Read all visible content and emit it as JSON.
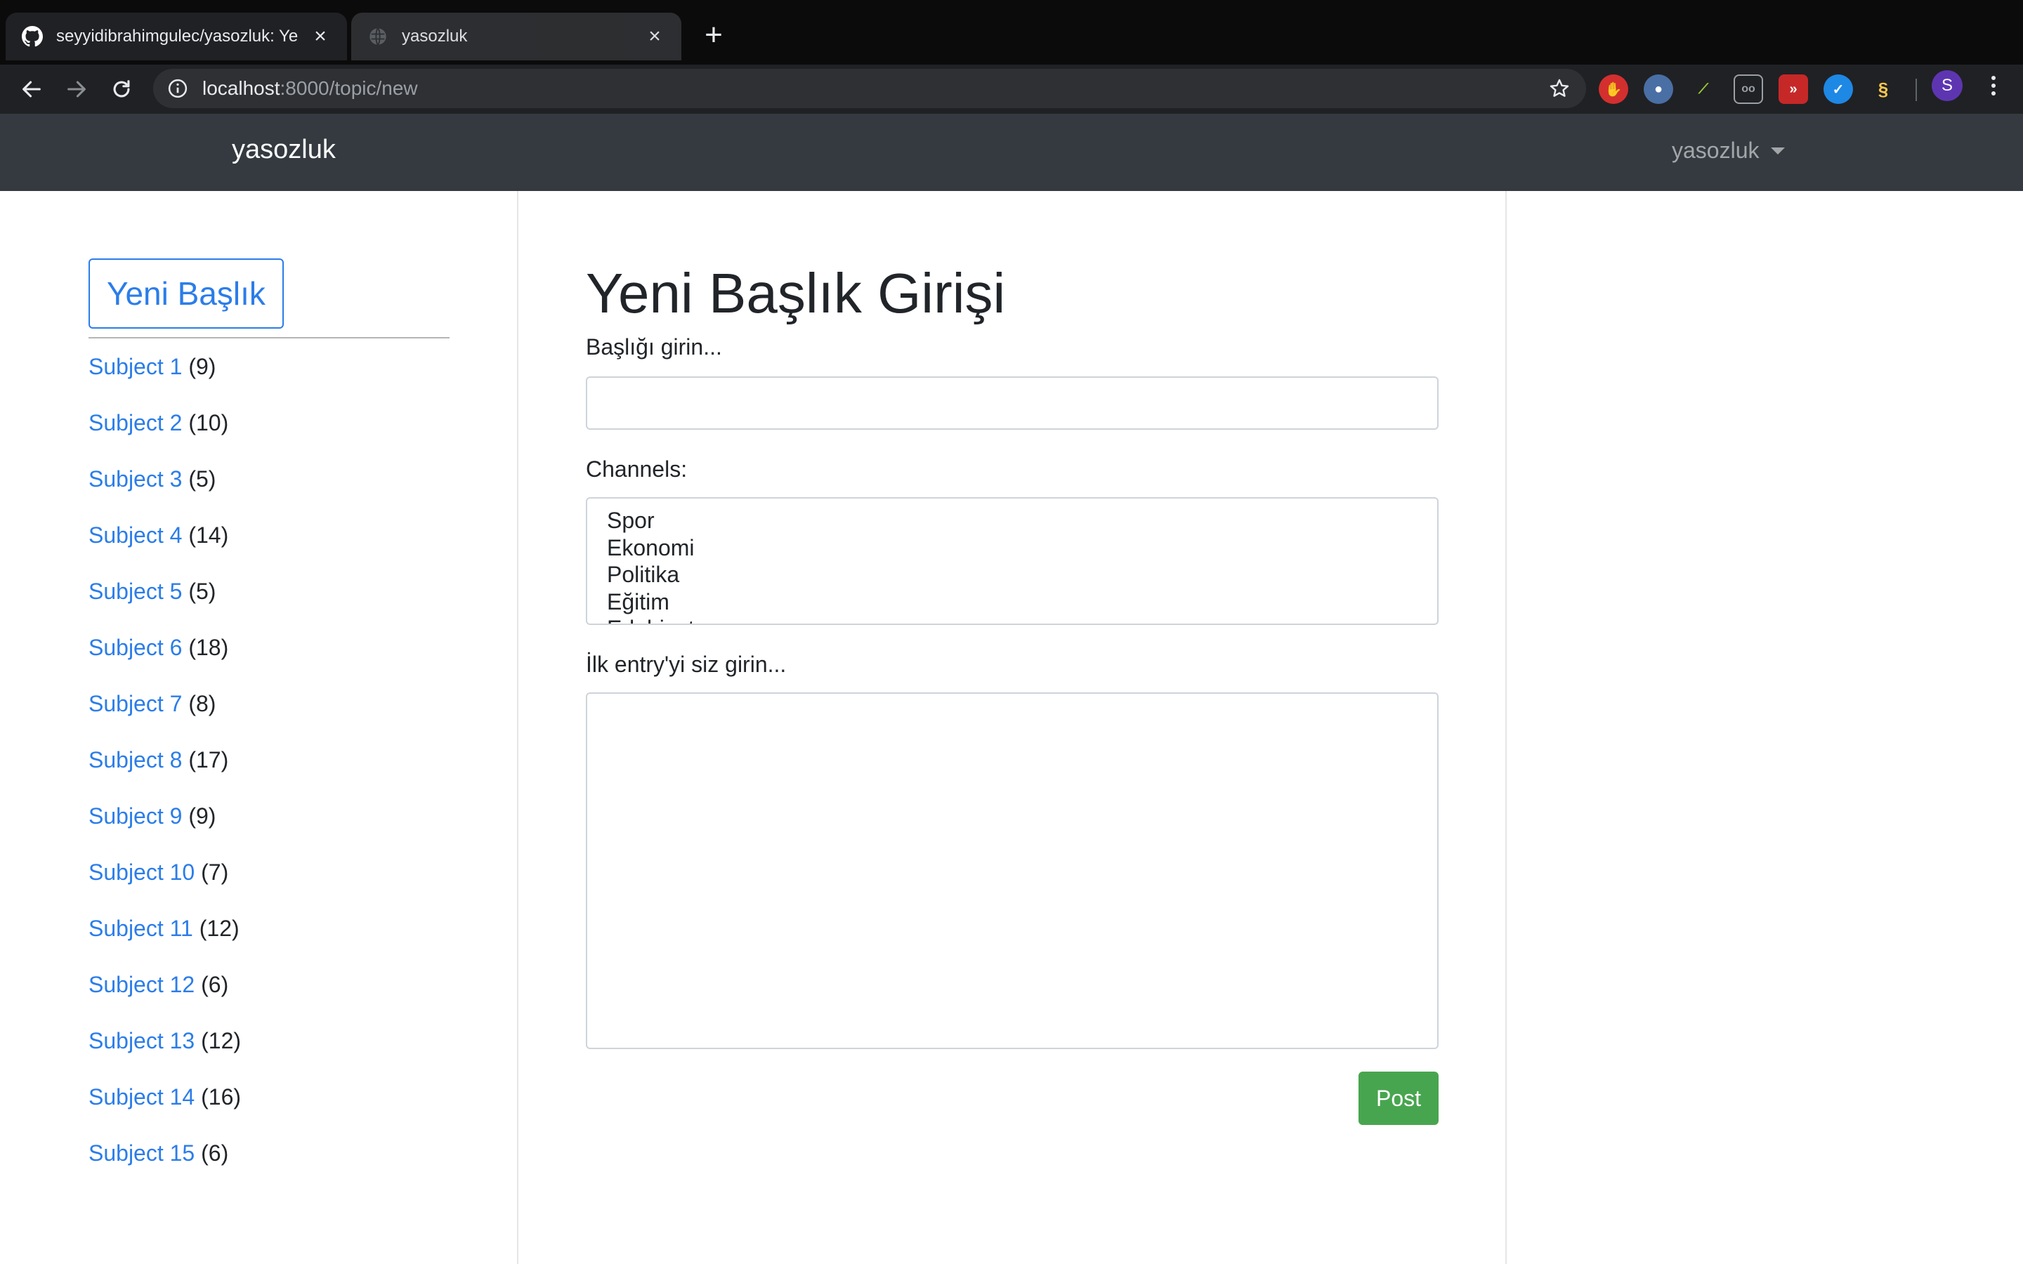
{
  "browser": {
    "tabs": [
      {
        "title": "seyyidibrahimgulec/yasozluk: Ye",
        "icon": "github-icon",
        "active": true
      },
      {
        "title": "yasozluk",
        "icon": "globe-icon",
        "active": false
      }
    ],
    "url_host": "localhost",
    "url_path": ":8000/topic/new",
    "profile_initial": "S"
  },
  "navbar": {
    "brand": "yasozluk",
    "user_menu": "yasozluk"
  },
  "sidebar": {
    "new_topic_label": "Yeni Başlık",
    "subjects": [
      {
        "name": "Subject 1",
        "count": "(9)"
      },
      {
        "name": "Subject 2",
        "count": "(10)"
      },
      {
        "name": "Subject 3",
        "count": "(5)"
      },
      {
        "name": "Subject 4",
        "count": "(14)"
      },
      {
        "name": "Subject 5",
        "count": "(5)"
      },
      {
        "name": "Subject 6",
        "count": "(18)"
      },
      {
        "name": "Subject 7",
        "count": "(8)"
      },
      {
        "name": "Subject 8",
        "count": "(17)"
      },
      {
        "name": "Subject 9",
        "count": "(9)"
      },
      {
        "name": "Subject 10",
        "count": "(7)"
      },
      {
        "name": "Subject 11",
        "count": "(12)"
      },
      {
        "name": "Subject 12",
        "count": "(6)"
      },
      {
        "name": "Subject 13",
        "count": "(12)"
      },
      {
        "name": "Subject 14",
        "count": "(16)"
      },
      {
        "name": "Subject 15",
        "count": "(6)"
      }
    ]
  },
  "form": {
    "title": "Yeni Başlık Girişi",
    "topic_label": "Başlığı girin...",
    "topic_value": "",
    "channels_label": "Channels:",
    "channels": [
      "Spor",
      "Ekonomi",
      "Politika",
      "Eğitim",
      "Edebiyat"
    ],
    "entry_label": "İlk entry'yi siz girin...",
    "entry_value": "",
    "submit_label": "Post"
  },
  "colors": {
    "navbar_bg": "#343a40",
    "link": "#2b7de9",
    "submit_bg": "#48a54f"
  }
}
